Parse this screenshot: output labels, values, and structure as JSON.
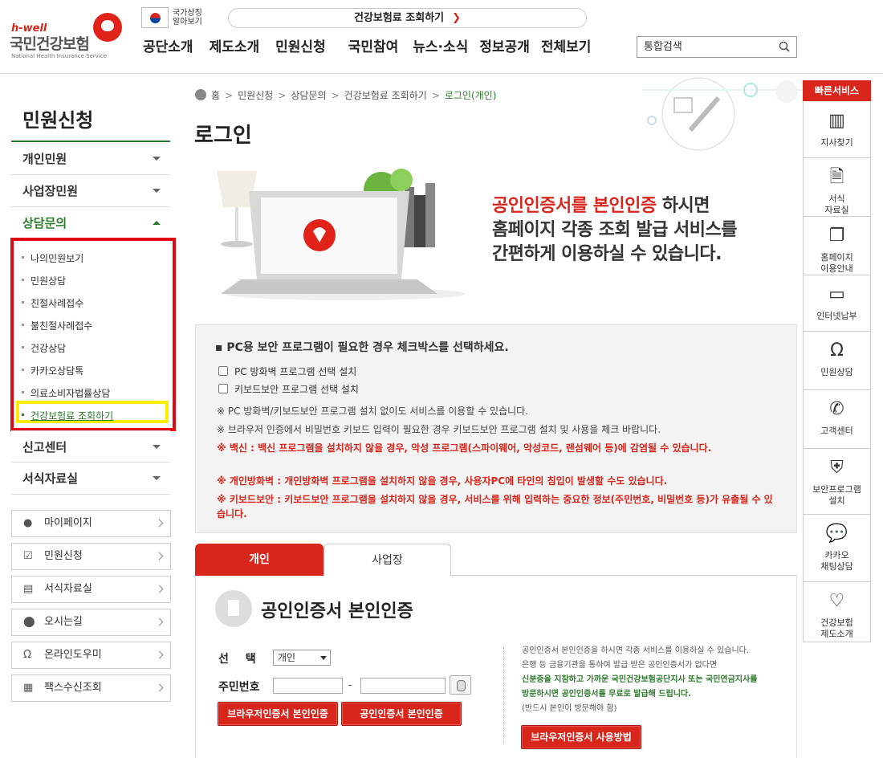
{
  "header": {
    "logo": {
      "tagline": "h-well",
      "name": "국민건강보험",
      "english": "National Health Insurance Service"
    },
    "flag_label": [
      "국가상징",
      "알아보기"
    ],
    "top_button": "건강보험료 조회하기",
    "nav": [
      "공단소개",
      "제도소개",
      "민원신청",
      "국민참여",
      "뉴스·소식",
      "정보공개",
      "전체보기"
    ],
    "search_placeholder": "통합검색"
  },
  "sidebar": {
    "title": "민원신청",
    "menu": [
      {
        "label": "개인민원",
        "open": false
      },
      {
        "label": "사업장민원",
        "open": false
      },
      {
        "label": "상담문의",
        "open": true
      }
    ],
    "submenu": [
      "나의민원보기",
      "민원상담",
      "친절사례접수",
      "불친절사례접수",
      "건강상담",
      "카카오상담톡",
      "의료소비자법률상담",
      "건강보험료 조회하기"
    ],
    "menu2": [
      "신고센터",
      "서식자료실"
    ],
    "quick": [
      {
        "label": "마이페이지",
        "icon": "person-icon"
      },
      {
        "label": "민원신청",
        "icon": "check-icon"
      },
      {
        "label": "서식자료실",
        "icon": "document-icon"
      },
      {
        "label": "오시는길",
        "icon": "location-icon"
      },
      {
        "label": "온라인도우미",
        "icon": "headset-icon"
      },
      {
        "label": "팩스수신조회",
        "icon": "fax-icon"
      }
    ]
  },
  "breadcrumb": [
    "홈",
    "민원신청",
    "상담문의",
    "건강보험료 조회하기",
    "로그인(개인)"
  ],
  "page_title": "로그인",
  "hero": {
    "line1_red": "공인인증서를 본인인증",
    "line1_rest": " 하시면",
    "line2": "홈페이지 각종 조회 발급 서비스를",
    "line3": "간편하게 이용하실 수 있습니다."
  },
  "security": {
    "title": "PC용 보안 프로그램이 필요한 경우 체크박스를 선택하세요.",
    "checks": [
      "PC 방화벽 프로그램 선택 설치",
      "키보드보안 프로그램 선택 설치"
    ],
    "notes": [
      "※ PC 방화벽/키보드보안 프로그램 설치 없이도 서비스를 이용할 수 있습니다.",
      "※ 브라우저 인증에서 비밀번호 키보드 입력이 필요한 경우 키보드보안 프로그램 설치 및 사용을 체크 바랍니다."
    ],
    "warnings": [
      "※ 백신 : 백신 프로그램을 설치하지 않을 경우, 악성 프로그램(스파이웨어, 악성코드, 랜섬웨어 등)에 감염될 수 있습니다.",
      "※ 개인방화벽 : 개인방화벽 프로그램을 설치하지 않을 경우, 사용자PC에 타인의 침입이 발생할 수도 있습니다.",
      "※ 키보드보안 : 키보드보안 프로그램을 설치하지 않을 경우, 서비스를 위해 입력하는 중요한 정보(주민번호, 비밀번호 등)가 유출될 수 있습니다."
    ]
  },
  "tabs": [
    "개인",
    "사업장"
  ],
  "cert": {
    "title": "공인인증서 본인인증",
    "select_label": "선 택",
    "select_value": "개인",
    "id_label": "주민번호",
    "dash": "-",
    "btn_browser": "브라우저인증서 본인인증",
    "btn_cert": "공인인증서 본인인증",
    "info": [
      "공인인증서 본인인증을 하시면 각종 서비스를 이용하실 수 있습니다.",
      "은행 등 금융기관을 통하여 발급 받은 공인인증서가 없다면",
      "신분증을 지참하고 가까운 국민건강보험공단지사 또는 국민연금지사를",
      "방문하시면 공인인증서를 무료로 발급해 드립니다.",
      "(반드시 본인이 방문해야 함)"
    ],
    "btn_howto": "브라우저인증서 사용방법"
  },
  "quickbar": {
    "title": "빠른서비스",
    "items": [
      {
        "label": "지사찾기",
        "icon": "building-icon"
      },
      {
        "label": "서식\n자료실",
        "icon": "search-doc-icon"
      },
      {
        "label": "홈페이지\n이용안내",
        "icon": "copy-icon"
      },
      {
        "label": "인터넷납부",
        "icon": "monitor-icon"
      },
      {
        "label": "민원상담",
        "icon": "headset-icon"
      },
      {
        "label": "고객센터",
        "icon": "phone-icon"
      },
      {
        "label": "보안프로그램\n설치",
        "icon": "shield-icon"
      },
      {
        "label": "카카오\n채팅상담",
        "icon": "talk-icon"
      },
      {
        "label": "건강보험\n제도소개",
        "icon": "heartbeat-icon"
      }
    ]
  }
}
